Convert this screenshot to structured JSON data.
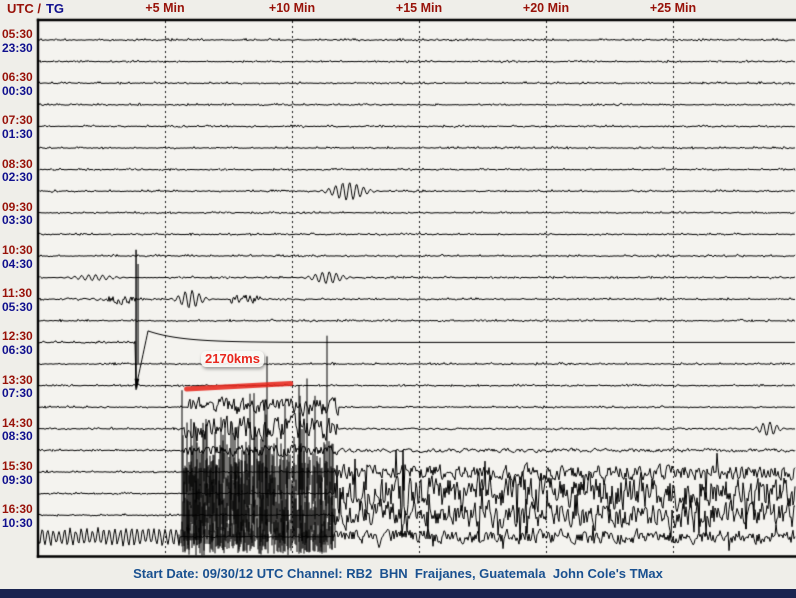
{
  "window": {
    "tz_header": {
      "utc": "UTC /",
      "local": "TG"
    }
  },
  "colors": {
    "label_red": "#981209",
    "label_navy": "#10108E",
    "footer_blue": "#1A5190",
    "annotation_red": "#E8271D",
    "trace_black": "#000000",
    "plot_bg": "#F4F3EF",
    "page_bg": "#EFEEE9",
    "bottom_bar": "#1A2450"
  },
  "x_axis": {
    "tick_labels": [
      "+5 Min",
      "+10 Min",
      "+15 Min",
      "+20 Min",
      "+25 Min"
    ],
    "tick_minutes": [
      5,
      10,
      15,
      20,
      25
    ],
    "minutes_per_line": 30
  },
  "rows": [
    {
      "utc": "05:30",
      "local": "23:30"
    },
    {
      "utc": "06:30",
      "local": "00:30"
    },
    {
      "utc": "07:30",
      "local": "01:30"
    },
    {
      "utc": "08:30",
      "local": "02:30"
    },
    {
      "utc": "09:30",
      "local": "03:30"
    },
    {
      "utc": "10:30",
      "local": "04:30"
    },
    {
      "utc": "11:30",
      "local": "05:30"
    },
    {
      "utc": "12:30",
      "local": "06:30"
    },
    {
      "utc": "13:30",
      "local": "07:30"
    },
    {
      "utc": "14:30",
      "local": "08:30"
    },
    {
      "utc": "15:30",
      "local": "09:30"
    },
    {
      "utc": "16:30",
      "local": "10:30"
    }
  ],
  "annotation": {
    "label": "2170kms",
    "start_min": 5.85,
    "end_min": 9.95,
    "row_utc": "13:30"
  },
  "footer": {
    "text": "Start Date: 09/30/12 UTC Channel: RB2  BHN  Fraijanes, Guatemala  John Cole's TMax"
  },
  "chart_data": {
    "type": "line",
    "variant": "helicorder-seismogram",
    "station": {
      "start_date_utc": "09/30/12",
      "channel": "RB2",
      "component": "BHN",
      "location": "Fraijanes, Guatemala",
      "software": "John Cole's TMax"
    },
    "minutes_per_line": 30,
    "traces": [
      {
        "start_utc": "05:30",
        "start_local": "23:30",
        "events": []
      },
      {
        "start_utc": "06:00",
        "start_local": "00:00",
        "events": []
      },
      {
        "start_utc": "06:30",
        "start_local": "00:30",
        "events": []
      },
      {
        "start_utc": "07:00",
        "start_local": "01:00",
        "events": []
      },
      {
        "start_utc": "07:30",
        "start_local": "01:30",
        "events": []
      },
      {
        "start_utc": "08:00",
        "start_local": "02:00",
        "events": []
      },
      {
        "start_utc": "08:30",
        "start_local": "02:30",
        "events": []
      },
      {
        "start_utc": "09:00",
        "start_local": "03:00",
        "events": [
          {
            "type": "wavelet",
            "t": 12.2,
            "amp": 9,
            "width": 0.5
          }
        ]
      },
      {
        "start_utc": "09:30",
        "start_local": "03:30",
        "events": []
      },
      {
        "start_utc": "10:00",
        "start_local": "04:00",
        "events": []
      },
      {
        "start_utc": "10:30",
        "start_local": "04:30",
        "events": []
      },
      {
        "start_utc": "11:00",
        "start_local": "05:00",
        "events": [
          {
            "type": "wavelet",
            "t": 2.2,
            "amp": 3,
            "width": 0.6
          },
          {
            "type": "wavelet",
            "t": 11.4,
            "amp": 6,
            "width": 0.45
          }
        ]
      },
      {
        "start_utc": "11:30",
        "start_local": "05:30",
        "events": [
          {
            "type": "noise",
            "t0": 0.7,
            "t1": 2.7,
            "amp": 1
          },
          {
            "type": "noise",
            "t0": 2.7,
            "t1": 3.8,
            "amp": 4.5
          },
          {
            "type": "wavelet",
            "t": 6.0,
            "amp": 9,
            "width": 0.35
          },
          {
            "type": "noise",
            "t0": 7.6,
            "t1": 8.8,
            "amp": 4
          },
          {
            "type": "noise",
            "t0": 8.8,
            "t1": 10.6,
            "amp": 1
          }
        ]
      },
      {
        "start_utc": "12:00",
        "start_local": "06:00",
        "events": [
          {
            "type": "spike",
            "t": 3.86,
            "up": 71,
            "down": 69
          }
        ]
      },
      {
        "start_utc": "12:30",
        "start_local": "06:30",
        "events": [
          {
            "type": "decay",
            "t": 3.86,
            "amp": 11.5,
            "tau": 1.3
          }
        ]
      },
      {
        "start_utc": "13:00",
        "start_local": "07:00",
        "events": []
      },
      {
        "start_utc": "13:30",
        "start_local": "07:30",
        "events": []
      },
      {
        "start_utc": "14:00",
        "start_local": "08:00",
        "events": [
          {
            "type": "noise",
            "t0": 5.9,
            "t1": 11.8,
            "amp": 8
          }
        ]
      },
      {
        "start_utc": "14:30",
        "start_local": "08:30",
        "events": [
          {
            "type": "noise",
            "t0": 5.75,
            "t1": 11.8,
            "amp": 11
          },
          {
            "type": "noise",
            "t0": 11.8,
            "t1": 29.9,
            "amp": 0.8
          },
          {
            "type": "wavelet",
            "t": 28.75,
            "amp": 7,
            "width": 0.3
          }
        ]
      },
      {
        "start_utc": "15:00",
        "start_local": "09:00",
        "events": [
          {
            "type": "noise",
            "t0": 5.75,
            "t1": 11.8,
            "amp": 5
          },
          {
            "type": "noise",
            "t0": 11.8,
            "t1": 29.9,
            "amp": 1.8
          }
        ]
      },
      {
        "start_utc": "15:30",
        "start_local": "09:30",
        "events": [
          {
            "type": "burst",
            "t0": 5.7,
            "t1": 11.7,
            "up": 30,
            "down": 34,
            "density": 0.7
          },
          {
            "type": "noise",
            "t0": 11.7,
            "t1": 29.9,
            "amp": 7,
            "spike": 24
          }
        ]
      },
      {
        "start_utc": "16:00",
        "start_local": "10:00",
        "events": [
          {
            "type": "burst",
            "t0": 5.65,
            "t1": 8.3,
            "up": 80,
            "down": 62,
            "density": 0.92
          },
          {
            "type": "burst",
            "t0": 8.3,
            "t1": 10.3,
            "up": 110,
            "down": 62,
            "density": 0.6
          },
          {
            "type": "burst",
            "t0": 10.3,
            "t1": 11.7,
            "up": 145,
            "down": 60,
            "density": 0.38
          },
          {
            "type": "noise",
            "t0": 11.7,
            "t1": 29.9,
            "amp": 16,
            "spike": 42
          }
        ]
      },
      {
        "start_utc": "16:30",
        "start_local": "10:30",
        "events": [
          {
            "type": "burst",
            "t0": 5.7,
            "t1": 11.7,
            "up": 42,
            "down": 38,
            "density": 0.85
          },
          {
            "type": "noise",
            "t0": 11.7,
            "t1": 29.9,
            "amp": 12,
            "spike": 26
          }
        ]
      },
      {
        "start_utc": "17:00",
        "start_local": "11:00",
        "events": [
          {
            "type": "sine",
            "t0": 0,
            "t1": 5.55,
            "amp": 8.5,
            "period": 0.22
          },
          {
            "type": "burst",
            "t0": 5.55,
            "t1": 11.7,
            "up": 19,
            "down": 17,
            "density": 0.8
          },
          {
            "type": "noise",
            "t0": 11.7,
            "t1": 29.9,
            "amp": 6.5,
            "spike": 14
          }
        ]
      }
    ]
  }
}
